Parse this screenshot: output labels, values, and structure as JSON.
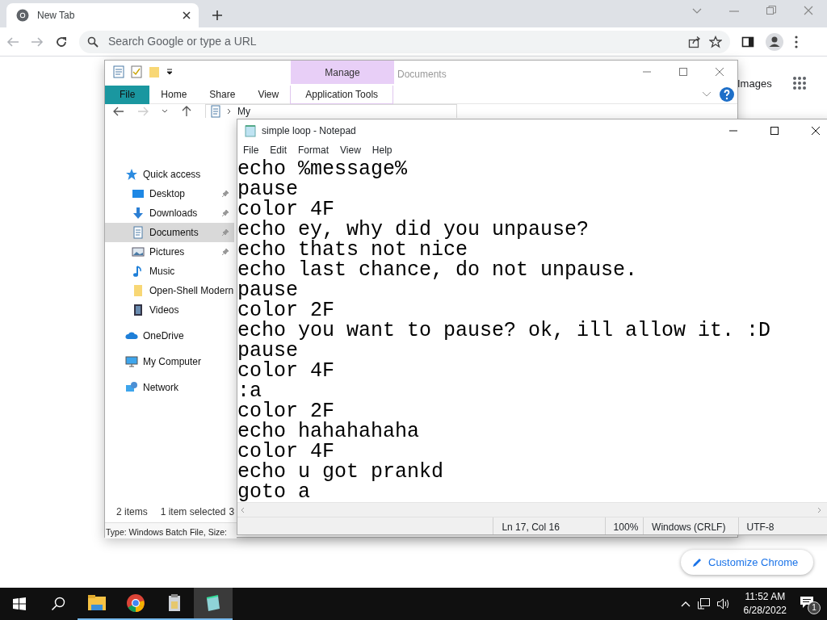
{
  "browser": {
    "tab": {
      "title": "New Tab"
    },
    "omnibox": {
      "placeholder": "Search Google or type a URL"
    },
    "images_link": "Images",
    "customize_button": "Customize Chrome"
  },
  "explorer": {
    "title": "Documents",
    "context_group": "Manage",
    "ribbon_tabs": [
      {
        "label": "File",
        "kind": "file"
      },
      {
        "label": "Home",
        "kind": "tab"
      },
      {
        "label": "Share",
        "kind": "tab"
      },
      {
        "label": "View",
        "kind": "tab"
      },
      {
        "label": "Application Tools",
        "kind": "context"
      }
    ],
    "address": "My",
    "nav": [
      {
        "label": "Quick access",
        "kind": "star",
        "selected": false,
        "children": [
          {
            "label": "Desktop",
            "kind": "desktop",
            "pinned": true,
            "selected": false
          },
          {
            "label": "Downloads",
            "kind": "download",
            "pinned": true,
            "selected": false
          },
          {
            "label": "Documents",
            "kind": "document",
            "pinned": true,
            "selected": true
          },
          {
            "label": "Pictures",
            "kind": "picture",
            "pinned": true,
            "selected": false
          },
          {
            "label": "Music",
            "kind": "music",
            "pinned": false,
            "selected": false
          },
          {
            "label": "Open-Shell Modern",
            "kind": "folder",
            "pinned": false,
            "selected": false
          },
          {
            "label": "Videos",
            "kind": "video",
            "pinned": false,
            "selected": false
          }
        ]
      },
      {
        "label": "OneDrive",
        "kind": "cloud",
        "selected": false
      },
      {
        "label": "My Computer",
        "kind": "computer",
        "selected": false
      },
      {
        "label": "Network",
        "kind": "network",
        "selected": false
      }
    ],
    "status": {
      "items": "2 items",
      "selected": "1 item selected",
      "size": "3"
    },
    "details": "Type: Windows Batch File, Size:"
  },
  "notepad": {
    "title": "simple loop - Notepad",
    "menu": [
      "File",
      "Edit",
      "Format",
      "View",
      "Help"
    ],
    "lines": [
      "echo %message%",
      "pause",
      "color 4F",
      "echo ey, why did you unpause?",
      "echo thats not nice",
      "echo last chance, do not unpause.",
      "pause",
      "color 2F",
      "echo you want to pause? ok, ill allow it. :D",
      "pause",
      "color 4F",
      ":a",
      "color 2F",
      "echo hahahahaha",
      "color 4F",
      "echo u got prankd",
      "goto a"
    ],
    "status": [
      "Ln 17, Col 16",
      "100%",
      "Windows (CRLF)",
      "UTF-8"
    ]
  },
  "taskbar": {
    "apps": [
      {
        "kind": "explorer",
        "active": false
      },
      {
        "kind": "chrome",
        "active": false
      },
      {
        "kind": "app",
        "active": false
      },
      {
        "kind": "notepad",
        "active": true
      }
    ],
    "time": "11:52 AM",
    "date": "6/28/2022",
    "notifications": "1"
  }
}
